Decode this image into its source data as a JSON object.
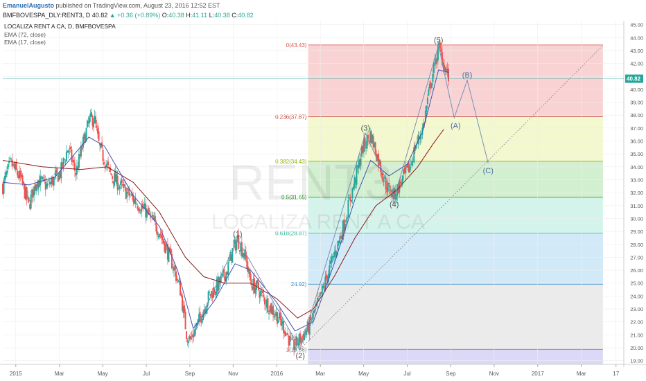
{
  "header": {
    "author": "EmanuelAugusto",
    "published_text": "published on TradingView.com, August 23, 2016 12:52 EST",
    "symbol": "BMFBOVESPA_DLY:RENT3, D",
    "last": "40.82",
    "change": "▲ +0.36 (+0.89%)",
    "open_label": "O:",
    "open": "40.38",
    "high_label": "H:",
    "high": "41.11",
    "low_label": "L:",
    "low": "40.38",
    "close_label": "C:",
    "close": "40.82"
  },
  "legend": {
    "title": "LOCALIZA RENT A CA, D, BMFBOVESPA",
    "ema1": "EMA (72, close)",
    "ema2": "EMA (17, close)"
  },
  "watermark": {
    "ticker": "RENT3",
    "name": "LOCALIZA RENT A CA"
  },
  "last_price_tag": "40.82",
  "colors": {
    "candle_up": "#26a69a",
    "candle_down": "#ef5350",
    "ema72": "#8b1a1a",
    "ema17": "#3f51b5",
    "wave": "#7a8fb0",
    "fib_0": "#f4a7a7",
    "fib_236": "#e8f2a0",
    "fib_382": "#a5e0a0",
    "fib_5": "#a8e8d8",
    "fib_618": "#a6d6f2",
    "fib_786": "#d8d8d8",
    "fib_1": "#b8b4f0"
  },
  "chart_data": {
    "type": "candlestick",
    "x_ticks": [
      "2015",
      "Mar",
      "May",
      "Jul",
      "Sep",
      "Nov",
      "2016",
      "Mar",
      "May",
      "Jul",
      "Sep",
      "Nov",
      "2017",
      "Mar",
      "17"
    ],
    "x_tick_pos": [
      2015.0,
      2015.167,
      2015.333,
      2015.5,
      2015.667,
      2015.833,
      2016.0,
      2016.167,
      2016.333,
      2016.5,
      2016.667,
      2016.833,
      2017.0,
      2017.167,
      2017.3
    ],
    "x_range": [
      2014.95,
      2017.33
    ],
    "y_ticks": [
      "19.00",
      "20.00",
      "21.00",
      "22.00",
      "23.00",
      "24.00",
      "25.00",
      "26.00",
      "27.00",
      "28.00",
      "29.00",
      "30.00",
      "31.00",
      "32.00",
      "33.00",
      "34.00",
      "35.00",
      "36.00",
      "37.00",
      "38.00",
      "39.00",
      "40.00",
      "41.00",
      "42.00",
      "43.00",
      "44.00",
      "45.00"
    ],
    "y_range": [
      18.5,
      45.3
    ],
    "price_anchors": [
      [
        2014.95,
        32.5
      ],
      [
        2014.98,
        34.3
      ],
      [
        2015.02,
        33.0
      ],
      [
        2015.05,
        31.0
      ],
      [
        2015.08,
        33.0
      ],
      [
        2015.12,
        32.5
      ],
      [
        2015.17,
        33.5
      ],
      [
        2015.2,
        35.5
      ],
      [
        2015.23,
        33.5
      ],
      [
        2015.26,
        36.0
      ],
      [
        2015.28,
        37.5
      ],
      [
        2015.3,
        37.8
      ],
      [
        2015.32,
        35.5
      ],
      [
        2015.36,
        33.5
      ],
      [
        2015.4,
        32.5
      ],
      [
        2015.45,
        31.5
      ],
      [
        2015.5,
        30.5
      ],
      [
        2015.55,
        29.0
      ],
      [
        2015.6,
        26.5
      ],
      [
        2015.63,
        24.5
      ],
      [
        2015.655,
        21.0
      ],
      [
        2015.67,
        20.6
      ],
      [
        2015.7,
        22.0
      ],
      [
        2015.74,
        24.0
      ],
      [
        2015.78,
        25.0
      ],
      [
        2015.81,
        26.0
      ],
      [
        2015.83,
        27.5
      ],
      [
        2015.85,
        28.4
      ],
      [
        2015.88,
        27.0
      ],
      [
        2015.9,
        25.0
      ],
      [
        2015.93,
        24.5
      ],
      [
        2015.96,
        23.5
      ],
      [
        2016.0,
        22.5
      ],
      [
        2016.03,
        21.5
      ],
      [
        2016.06,
        20.0
      ],
      [
        2016.09,
        20.7
      ],
      [
        2016.12,
        21.5
      ],
      [
        2016.16,
        23.5
      ],
      [
        2016.2,
        26.0
      ],
      [
        2016.25,
        29.0
      ],
      [
        2016.3,
        33.0
      ],
      [
        2016.33,
        35.5
      ],
      [
        2016.36,
        36.5
      ],
      [
        2016.39,
        34.5
      ],
      [
        2016.42,
        32.5
      ],
      [
        2016.45,
        31.8
      ],
      [
        2016.48,
        33.0
      ],
      [
        2016.51,
        34.0
      ],
      [
        2016.53,
        35.5
      ],
      [
        2016.56,
        37.0
      ],
      [
        2016.59,
        40.5
      ],
      [
        2016.62,
        43.3
      ],
      [
        2016.64,
        42.0
      ],
      [
        2016.66,
        40.8
      ]
    ],
    "ema17": [
      [
        2014.95,
        32.8
      ],
      [
        2015.05,
        32.6
      ],
      [
        2015.15,
        33.2
      ],
      [
        2015.28,
        36.3
      ],
      [
        2015.34,
        35.6
      ],
      [
        2015.45,
        31.8
      ],
      [
        2015.55,
        29.4
      ],
      [
        2015.62,
        26.0
      ],
      [
        2015.68,
        21.5
      ],
      [
        2015.76,
        23.6
      ],
      [
        2015.84,
        26.5
      ],
      [
        2015.9,
        26.0
      ],
      [
        2016.0,
        23.5
      ],
      [
        2016.07,
        21.3
      ],
      [
        2016.14,
        22.0
      ],
      [
        2016.22,
        26.5
      ],
      [
        2016.3,
        31.5
      ],
      [
        2016.36,
        34.5
      ],
      [
        2016.43,
        33.3
      ],
      [
        2016.5,
        34.2
      ],
      [
        2016.56,
        36.8
      ],
      [
        2016.62,
        41.5
      ],
      [
        2016.66,
        41.3
      ]
    ],
    "ema72": [
      [
        2014.95,
        34.5
      ],
      [
        2015.1,
        34.0
      ],
      [
        2015.25,
        33.8
      ],
      [
        2015.35,
        34.0
      ],
      [
        2015.45,
        32.8
      ],
      [
        2015.55,
        30.5
      ],
      [
        2015.65,
        27.0
      ],
      [
        2015.72,
        25.5
      ],
      [
        2015.8,
        25.0
      ],
      [
        2015.9,
        25.0
      ],
      [
        2016.0,
        23.8
      ],
      [
        2016.08,
        22.3
      ],
      [
        2016.14,
        23.0
      ],
      [
        2016.22,
        25.5
      ],
      [
        2016.3,
        28.5
      ],
      [
        2016.38,
        31.0
      ],
      [
        2016.46,
        32.2
      ],
      [
        2016.54,
        34.0
      ],
      [
        2016.6,
        35.8
      ],
      [
        2016.64,
        36.9
      ]
    ],
    "fib_retracement": {
      "x_start": 2016.12,
      "x_end": 2017.25,
      "levels": [
        {
          "ratio": "0",
          "price": 43.43,
          "label": "0(43.43)"
        },
        {
          "ratio": "0.236",
          "price": 37.87,
          "label": "0.236(37.87)"
        },
        {
          "ratio": "0.382",
          "price": 34.43,
          "label": "0.382(34.43)"
        },
        {
          "ratio": "0.5",
          "price": 31.65,
          "label": "0.5(31.65)"
        },
        {
          "ratio": "0.618",
          "price": 28.87,
          "label": "0.618(28.87)"
        },
        {
          "ratio": "0.786",
          "price": 24.92,
          "label": "24.92)"
        },
        {
          "ratio": "1",
          "price": 19.88,
          "label": "1(19.88)"
        }
      ]
    },
    "trend_line": [
      [
        2016.09,
        19.9
      ],
      [
        2017.25,
        43.4
      ]
    ],
    "waves": [
      {
        "label": "(1)",
        "x": 2015.85,
        "y": 28.4
      },
      {
        "label": "(2)",
        "x": 2016.09,
        "y": 19.9
      },
      {
        "label": "(3)",
        "x": 2016.34,
        "y": 36.6
      },
      {
        "label": "(4)",
        "x": 2016.45,
        "y": 31.6
      },
      {
        "label": "(5)",
        "x": 2016.62,
        "y": 43.4
      }
    ],
    "projection": [
      {
        "label": "",
        "x": 2016.645,
        "y": 41.0
      },
      {
        "label": "(A)",
        "x": 2016.68,
        "y": 37.8
      },
      {
        "label": "(B)",
        "x": 2016.73,
        "y": 40.7
      },
      {
        "label": "(C)",
        "x": 2016.81,
        "y": 34.3
      }
    ]
  }
}
